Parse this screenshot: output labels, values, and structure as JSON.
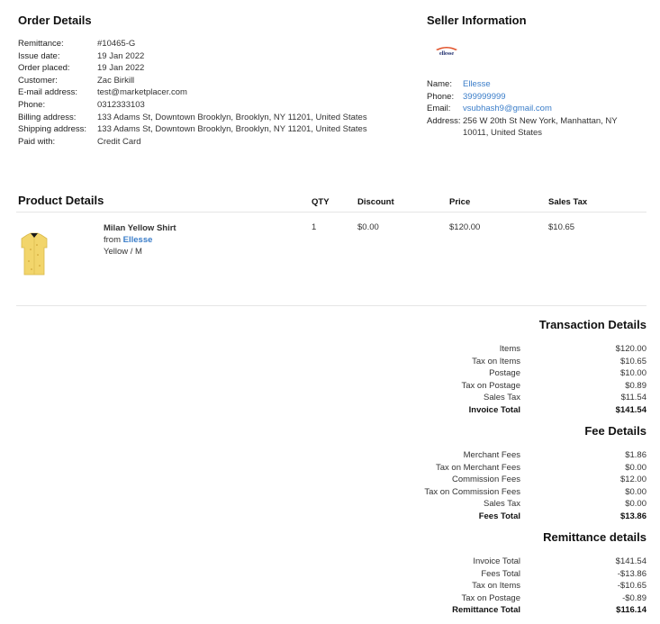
{
  "order_details": {
    "title": "Order Details",
    "rows": [
      {
        "label": "Remittance:",
        "value": "#10465-G"
      },
      {
        "label": "Issue date:",
        "value": "19 Jan 2022"
      },
      {
        "label": "Order placed:",
        "value": "19 Jan 2022"
      },
      {
        "label": "Customer:",
        "value": "Zac Birkill"
      },
      {
        "label": "E-mail address:",
        "value": "test@marketplacer.com"
      },
      {
        "label": "Phone:",
        "value": "0312333103"
      },
      {
        "label": "Billing address:",
        "value": "133 Adams St, Downtown Brooklyn, Brooklyn, NY 11201, United States"
      },
      {
        "label": "Shipping address:",
        "value": "133 Adams St, Downtown Brooklyn, Brooklyn, NY 11201, United States"
      },
      {
        "label": "Paid with:",
        "value": "Credit Card"
      }
    ]
  },
  "seller": {
    "title": "Seller Information",
    "logo_text": "ellesse",
    "name_label": "Name:",
    "name": "Ellesse",
    "phone_label": "Phone:",
    "phone": "399999999",
    "email_label": "Email:",
    "email": "vsubhash9@gmail.com",
    "address_label": "Address:",
    "address_line1": "256 W 20th St New York, Manhattan, NY",
    "address_line2": "10011, United States"
  },
  "product_details": {
    "title": "Product Details",
    "columns": {
      "qty": "QTY",
      "discount": "Discount",
      "price": "Price",
      "sales_tax": "Sales Tax"
    },
    "item": {
      "name": "Milan Yellow Shirt",
      "from_label": "from",
      "brand": "Ellesse",
      "variant": "Yellow / M",
      "qty": "1",
      "discount": "$0.00",
      "price": "$120.00",
      "sales_tax": "$10.65"
    }
  },
  "transaction_details": {
    "title": "Transaction Details",
    "rows": [
      {
        "label": "Items",
        "value": "$120.00"
      },
      {
        "label": "Tax on Items",
        "value": "$10.65"
      },
      {
        "label": "Postage",
        "value": "$10.00"
      },
      {
        "label": "Tax on Postage",
        "value": "$0.89"
      },
      {
        "label": "Sales Tax",
        "value": "$11.54"
      }
    ],
    "total_label": "Invoice Total",
    "total_value": "$141.54"
  },
  "fee_details": {
    "title": "Fee Details",
    "rows": [
      {
        "label": "Merchant Fees",
        "value": "$1.86"
      },
      {
        "label": "Tax on Merchant Fees",
        "value": "$0.00"
      },
      {
        "label": "Commission Fees",
        "value": "$12.00"
      },
      {
        "label": "Tax on Commission Fees",
        "value": "$0.00"
      },
      {
        "label": "Sales Tax",
        "value": "$0.00"
      }
    ],
    "total_label": "Fees Total",
    "total_value": "$13.86"
  },
  "remittance_details": {
    "title": "Remittance details",
    "rows": [
      {
        "label": "Invoice Total",
        "value": "$141.54"
      },
      {
        "label": "Fees Total",
        "value": "-$13.86"
      },
      {
        "label": "Tax on Items",
        "value": "-$10.65"
      },
      {
        "label": "Tax on Postage",
        "value": "-$0.89"
      }
    ],
    "total_label": "Remittance Total",
    "total_value": "$116.14"
  }
}
